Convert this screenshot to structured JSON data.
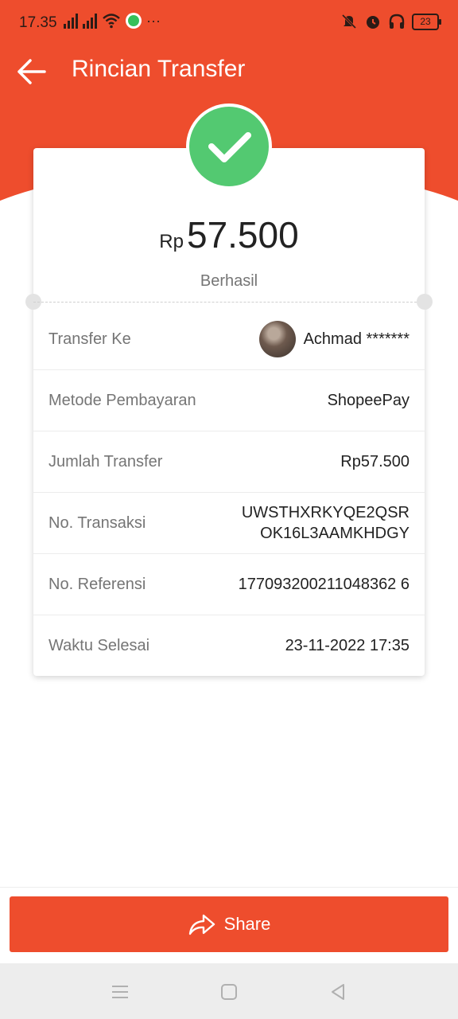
{
  "status_bar": {
    "time": "17.35",
    "battery": "23"
  },
  "app_bar": {
    "title": "Rincian Transfer"
  },
  "summary": {
    "currency_prefix": "Rp",
    "amount": "57.500",
    "status": "Berhasil"
  },
  "details": [
    {
      "label": "Transfer Ke",
      "value": "Achmad *******"
    },
    {
      "label": "Metode Pembayaran",
      "value": "ShopeePay"
    },
    {
      "label": "Jumlah Transfer",
      "value": "Rp57.500"
    },
    {
      "label": "No. Transaksi",
      "value_line1": "UWSTHXRKYQE2QSR",
      "value_line2": "OK16L3AAMKHDGY"
    },
    {
      "label": "No. Referensi",
      "value": "177093200211048362 6"
    },
    {
      "label": "Waktu Selesai",
      "value": "23-11-2022 17:35"
    }
  ],
  "actions": {
    "share_label": "Share"
  },
  "colors": {
    "brand": "#ee4d2d",
    "success": "#53c971"
  }
}
